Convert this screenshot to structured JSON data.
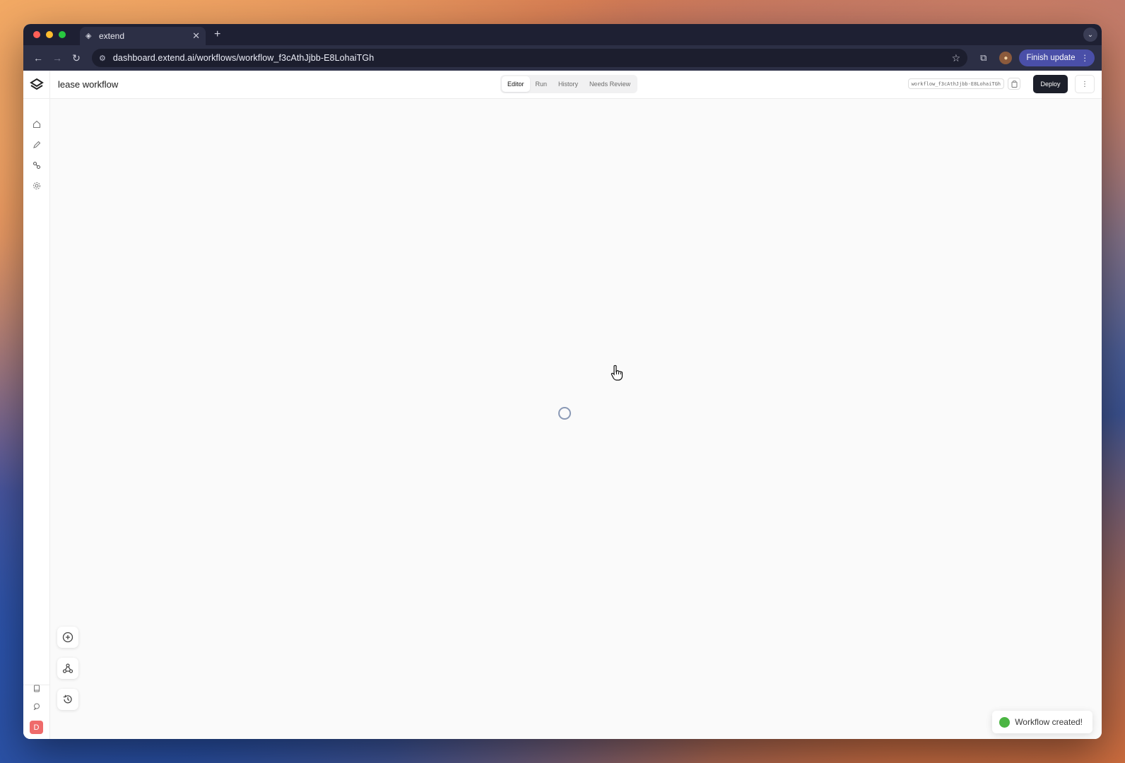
{
  "browser": {
    "tab_title": "extend",
    "url": "dashboard.extend.ai/workflows/workflow_f3cAthJjbb-E8LohaiTGh",
    "finish_update_label": "Finish update"
  },
  "app": {
    "page_title": "lease workflow",
    "tabs": [
      {
        "label": "Editor",
        "active": true
      },
      {
        "label": "Run",
        "active": false
      },
      {
        "label": "History",
        "active": false
      },
      {
        "label": "Needs Review",
        "active": false
      }
    ],
    "workflow_id": "workflow_f3cAthJjbb-E8LohaiTGh",
    "deploy_label": "Deploy",
    "user_initial": "D"
  },
  "toast": {
    "message": "Workflow created!"
  },
  "colors": {
    "deploy_bg": "#1c1f2a",
    "finish_update_bg": "#4a4fa8",
    "user_avatar": "#ef6b6b",
    "toast_success": "#4bb543"
  }
}
